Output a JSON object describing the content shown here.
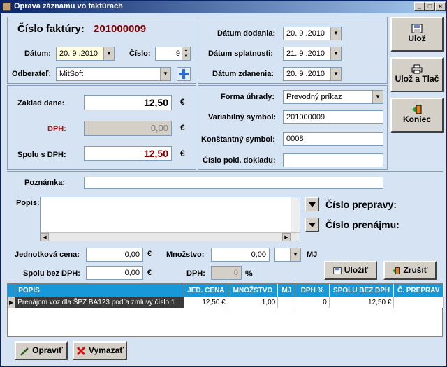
{
  "window": {
    "title": "Oprava záznamu vo faktúrach"
  },
  "invoice": {
    "label": "Číslo faktúry:",
    "number": "201000009"
  },
  "header": {
    "datum_label": "Dátum:",
    "datum_value": "20. 9 .2010",
    "cislo_label": "Číslo:",
    "cislo_value": "9",
    "odberatel_label": "Odberateľ:",
    "odberatel_value": "MitSoft"
  },
  "amounts": {
    "zaklad_label": "Základ dane:",
    "zaklad_value": "12,50",
    "dph_label": "DPH:",
    "dph_value": "0,00",
    "spolu_label": "Spolu s DPH:",
    "spolu_value": "12,50",
    "currency": "€"
  },
  "dates": {
    "dodania_label": "Dátum dodania:",
    "dodania_value": "20. 9 .2010",
    "splatnosti_label": "Dátum splatnosti:",
    "splatnosti_value": "21. 9 .2010",
    "zdanenia_label": "Dátum zdanenia:",
    "zdanenia_value": "20. 9 .2010"
  },
  "payment": {
    "forma_label": "Forma úhrady:",
    "forma_value": "Prevodný príkaz",
    "vs_label": "Variabilný symbol:",
    "vs_value": "201000009",
    "ks_label": "Konštantný symbol:",
    "ks_value": "0008",
    "pokl_label": "Číslo pokl. dokladu:",
    "pokl_value": ""
  },
  "buttons": {
    "uloz": "Ulož",
    "uloz_tlac": "Ulož a Tlač",
    "koniec": "Koniec",
    "ulozit": "Uložiť",
    "zrusit": "Zrušiť",
    "opravit": "Opraviť",
    "vymazat": "Vymazať"
  },
  "note": {
    "label": "Poznámka:",
    "value": ""
  },
  "item": {
    "popis_label": "Popis:",
    "prepravy_label": "Číslo prepravy:",
    "prenajmu_label": "Číslo prenájmu:",
    "jedn_cena_label": "Jednotková cena:",
    "jedn_cena_value": "0,00",
    "mnozstvo_label": "Množstvo:",
    "mnozstvo_value": "0,00",
    "mj_label": "MJ",
    "spolu_bez_label": "Spolu bez DPH:",
    "spolu_bez_value": "0,00",
    "dph_label": "DPH:",
    "dph_value": "0",
    "percent": "%"
  },
  "table": {
    "columns": [
      "POPIS",
      "JED. CENA",
      "MNOŽSTVO",
      "MJ",
      "DPH %",
      "SPOLU BEZ DPH",
      "Č. PREPRAV"
    ],
    "rows": [
      [
        "Prenájom vozidla ŠPZ BA123 podľa zmluvy číslo 1",
        "12,50 €",
        "1,00",
        "",
        "0",
        "12,50 €",
        ""
      ]
    ]
  }
}
